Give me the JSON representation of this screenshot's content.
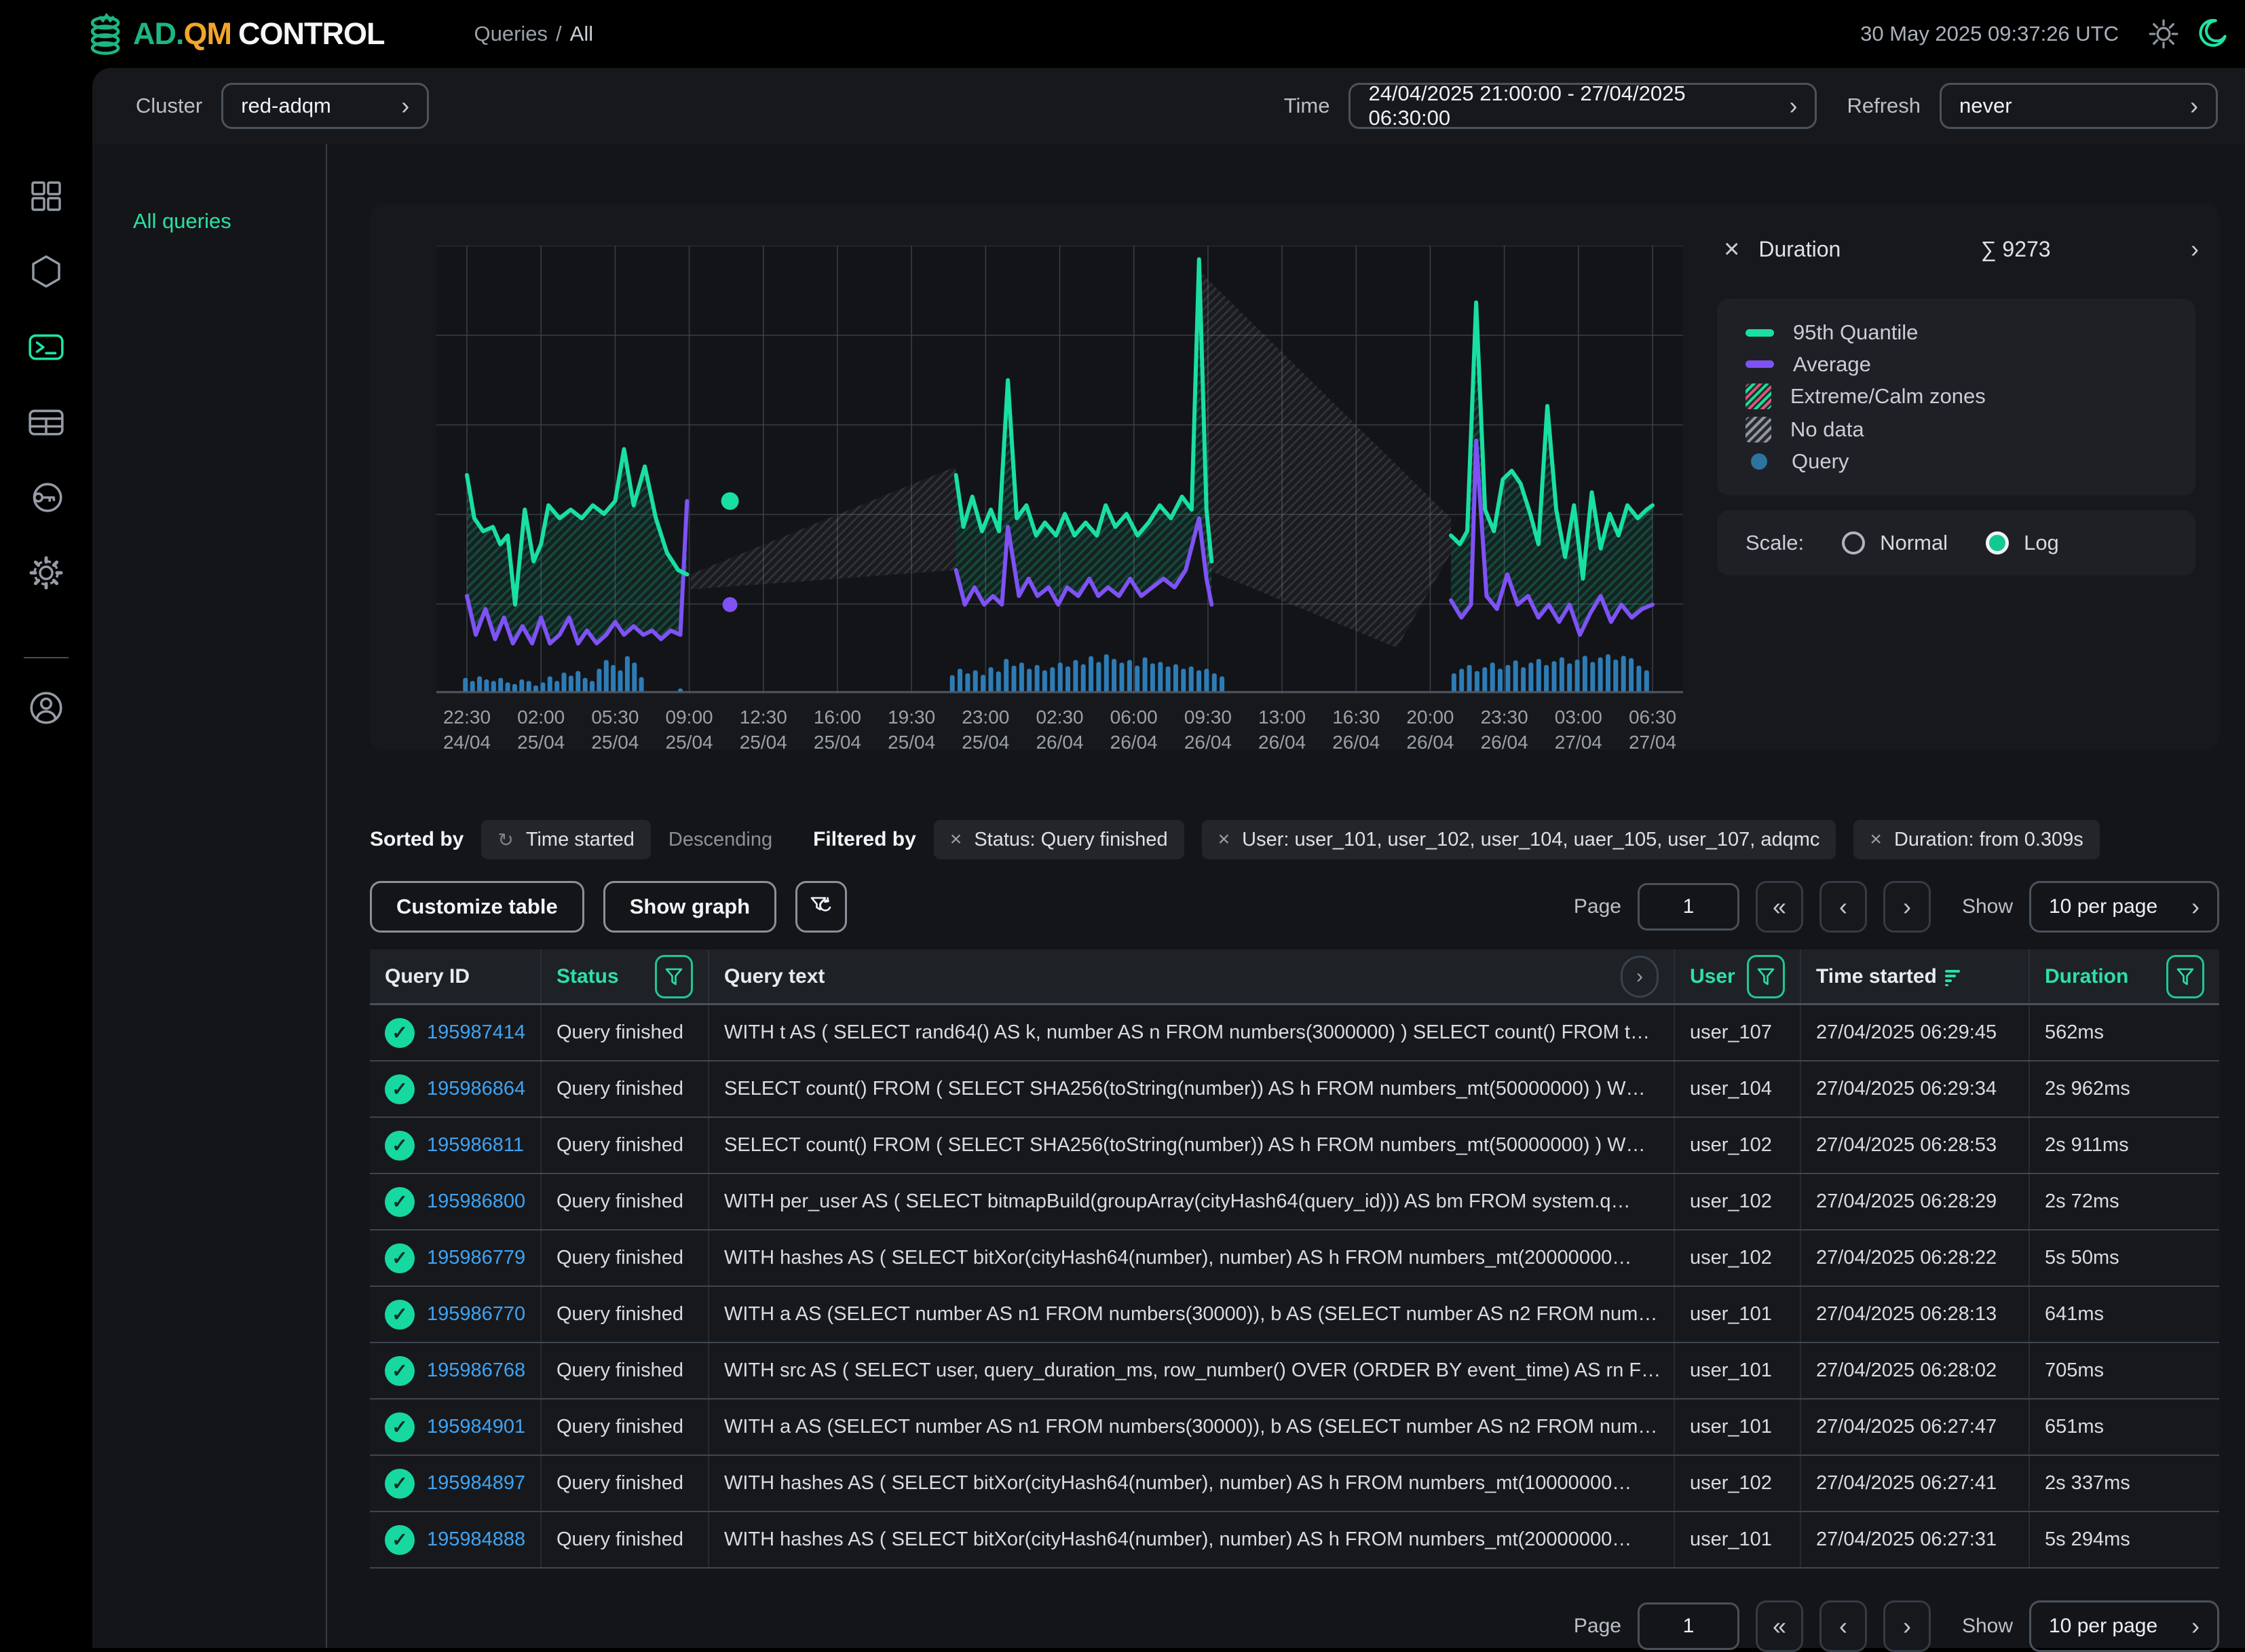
{
  "header": {
    "brand": {
      "ad": "AD.",
      "qm": "QM",
      "control": "CONTROL"
    },
    "breadcrumb": {
      "section": "Queries",
      "separator": "/",
      "page": "All"
    },
    "datetime": "30 May 2025 09:37:26 UTC"
  },
  "sidebar": {
    "items": [
      {
        "name": "dashboard",
        "icon": "grid-icon",
        "active": false
      },
      {
        "name": "nodes",
        "icon": "hexagon-icon",
        "active": false
      },
      {
        "name": "queries",
        "icon": "terminal-icon",
        "active": true
      },
      {
        "name": "tables",
        "icon": "table-icon",
        "active": false
      },
      {
        "name": "access",
        "icon": "key-icon",
        "active": false
      },
      {
        "name": "settings",
        "icon": "gear-icon",
        "active": false
      },
      {
        "name": "profile",
        "icon": "user-icon",
        "active": false
      }
    ]
  },
  "toolbar": {
    "cluster": {
      "label": "Cluster",
      "value": "red-adqm"
    },
    "time": {
      "label": "Time",
      "value": "24/04/2025 21:00:00 - 27/04/2025 06:30:00"
    },
    "refresh": {
      "label": "Refresh",
      "value": "never"
    }
  },
  "nav_panel": {
    "all_queries": "All queries"
  },
  "chart_data": {
    "type": "line",
    "title": "Duration",
    "sum_sigma": "∑",
    "sum_value": "9273",
    "expand_chevron": "›",
    "scale": {
      "label": "Scale:",
      "options": [
        "Normal",
        "Log"
      ],
      "selected": "Log"
    },
    "legend": [
      {
        "label": "95th Quantile",
        "swatch": "line-green"
      },
      {
        "label": "Average",
        "swatch": "line-purple"
      },
      {
        "label": "Extreme/Calm zones",
        "swatch": "hatch-zones"
      },
      {
        "label": "No data",
        "swatch": "hatch-nodata"
      },
      {
        "label": "Query",
        "swatch": "dot-blue"
      }
    ],
    "colors": {
      "q95": "#19dfa2",
      "avg": "#7e52f5",
      "histogram": "#2e7cb5",
      "query_dot": "#2d739f",
      "grid": "#3d444d"
    },
    "x_ticks": [
      {
        "time": "22:30",
        "date": "24/04"
      },
      {
        "time": "02:00",
        "date": "25/04"
      },
      {
        "time": "05:30",
        "date": "25/04"
      },
      {
        "time": "09:00",
        "date": "25/04"
      },
      {
        "time": "12:30",
        "date": "25/04"
      },
      {
        "time": "16:00",
        "date": "25/04"
      },
      {
        "time": "19:30",
        "date": "25/04"
      },
      {
        "time": "23:00",
        "date": "25/04"
      },
      {
        "time": "02:30",
        "date": "26/04"
      },
      {
        "time": "06:00",
        "date": "26/04"
      },
      {
        "time": "09:30",
        "date": "26/04"
      },
      {
        "time": "13:00",
        "date": "26/04"
      },
      {
        "time": "16:30",
        "date": "26/04"
      },
      {
        "time": "20:00",
        "date": "26/04"
      },
      {
        "time": "23:30",
        "date": "26/04"
      },
      {
        "time": "03:00",
        "date": "27/04"
      },
      {
        "time": "06:30",
        "date": "27/04"
      }
    ],
    "series": {
      "q95_segments": [
        [
          [
            0,
            0.5
          ],
          [
            0.1,
            0.4
          ],
          [
            0.22,
            0.37
          ],
          [
            0.35,
            0.38
          ],
          [
            0.45,
            0.34
          ],
          [
            0.55,
            0.36
          ],
          [
            0.65,
            0.2
          ],
          [
            0.78,
            0.42
          ],
          [
            0.9,
            0.3
          ],
          [
            1.0,
            0.34
          ],
          [
            1.1,
            0.43
          ],
          [
            1.25,
            0.4
          ],
          [
            1.4,
            0.42
          ],
          [
            1.55,
            0.4
          ],
          [
            1.7,
            0.43
          ],
          [
            1.85,
            0.41
          ],
          [
            2.0,
            0.44
          ],
          [
            2.12,
            0.56
          ],
          [
            2.25,
            0.43
          ],
          [
            2.4,
            0.52
          ],
          [
            2.55,
            0.4
          ],
          [
            2.7,
            0.32
          ],
          [
            2.85,
            0.28
          ],
          [
            2.97,
            0.27
          ]
        ],
        [
          [
            6.6,
            0.5
          ],
          [
            6.7,
            0.38
          ],
          [
            6.82,
            0.45
          ],
          [
            6.95,
            0.37
          ],
          [
            7.07,
            0.42
          ],
          [
            7.18,
            0.37
          ],
          [
            7.3,
            0.72
          ],
          [
            7.42,
            0.4
          ],
          [
            7.55,
            0.43
          ],
          [
            7.68,
            0.36
          ],
          [
            7.8,
            0.39
          ],
          [
            7.95,
            0.36
          ],
          [
            8.07,
            0.41
          ],
          [
            8.2,
            0.36
          ],
          [
            8.35,
            0.39
          ],
          [
            8.5,
            0.36
          ],
          [
            8.62,
            0.43
          ],
          [
            8.75,
            0.38
          ],
          [
            8.9,
            0.41
          ],
          [
            9.05,
            0.36
          ],
          [
            9.2,
            0.39
          ],
          [
            9.35,
            0.43
          ],
          [
            9.5,
            0.4
          ],
          [
            9.65,
            0.45
          ],
          [
            9.78,
            0.42
          ],
          [
            9.88,
            1.0
          ],
          [
            9.98,
            0.42
          ],
          [
            10.05,
            0.3
          ]
        ],
        [
          [
            13.28,
            0.36
          ],
          [
            13.4,
            0.34
          ],
          [
            13.5,
            0.37
          ],
          [
            13.62,
            0.9
          ],
          [
            13.74,
            0.42
          ],
          [
            13.86,
            0.37
          ],
          [
            13.98,
            0.49
          ],
          [
            14.1,
            0.51
          ],
          [
            14.22,
            0.48
          ],
          [
            14.35,
            0.41
          ],
          [
            14.46,
            0.34
          ],
          [
            14.58,
            0.66
          ],
          [
            14.7,
            0.42
          ],
          [
            14.82,
            0.31
          ],
          [
            14.94,
            0.43
          ],
          [
            15.06,
            0.26
          ],
          [
            15.18,
            0.46
          ],
          [
            15.3,
            0.33
          ],
          [
            15.42,
            0.41
          ],
          [
            15.54,
            0.36
          ],
          [
            15.66,
            0.43
          ],
          [
            15.8,
            0.4
          ],
          [
            15.92,
            0.42
          ],
          [
            16.0,
            0.43
          ]
        ]
      ],
      "avg_segments": [
        [
          [
            0,
            0.22
          ],
          [
            0.12,
            0.13
          ],
          [
            0.25,
            0.19
          ],
          [
            0.38,
            0.12
          ],
          [
            0.5,
            0.17
          ],
          [
            0.62,
            0.11
          ],
          [
            0.75,
            0.15
          ],
          [
            0.88,
            0.11
          ],
          [
            1.0,
            0.17
          ],
          [
            1.12,
            0.11
          ],
          [
            1.25,
            0.13
          ],
          [
            1.38,
            0.17
          ],
          [
            1.5,
            0.11
          ],
          [
            1.62,
            0.14
          ],
          [
            1.75,
            0.11
          ],
          [
            1.88,
            0.13
          ],
          [
            2.0,
            0.16
          ],
          [
            2.12,
            0.13
          ],
          [
            2.25,
            0.15
          ],
          [
            2.38,
            0.13
          ],
          [
            2.5,
            0.14
          ],
          [
            2.62,
            0.12
          ],
          [
            2.75,
            0.14
          ],
          [
            2.88,
            0.13
          ],
          [
            2.97,
            0.44
          ]
        ],
        [
          [
            6.6,
            0.28
          ],
          [
            6.72,
            0.2
          ],
          [
            6.85,
            0.24
          ],
          [
            6.98,
            0.2
          ],
          [
            7.1,
            0.22
          ],
          [
            7.22,
            0.2
          ],
          [
            7.3,
            0.38
          ],
          [
            7.45,
            0.22
          ],
          [
            7.58,
            0.26
          ],
          [
            7.7,
            0.22
          ],
          [
            7.85,
            0.24
          ],
          [
            7.98,
            0.2
          ],
          [
            8.1,
            0.24
          ],
          [
            8.25,
            0.22
          ],
          [
            8.4,
            0.26
          ],
          [
            8.52,
            0.22
          ],
          [
            8.65,
            0.24
          ],
          [
            8.8,
            0.22
          ],
          [
            8.95,
            0.26
          ],
          [
            9.1,
            0.22
          ],
          [
            9.25,
            0.24
          ],
          [
            9.4,
            0.26
          ],
          [
            9.55,
            0.24
          ],
          [
            9.7,
            0.28
          ],
          [
            9.88,
            0.4
          ],
          [
            9.98,
            0.26
          ],
          [
            10.05,
            0.2
          ]
        ],
        [
          [
            13.28,
            0.21
          ],
          [
            13.42,
            0.17
          ],
          [
            13.55,
            0.2
          ],
          [
            13.62,
            0.58
          ],
          [
            13.76,
            0.22
          ],
          [
            13.9,
            0.19
          ],
          [
            14.04,
            0.27
          ],
          [
            14.18,
            0.2
          ],
          [
            14.32,
            0.22
          ],
          [
            14.46,
            0.17
          ],
          [
            14.6,
            0.2
          ],
          [
            14.74,
            0.16
          ],
          [
            14.88,
            0.2
          ],
          [
            15.02,
            0.13
          ],
          [
            15.16,
            0.18
          ],
          [
            15.3,
            0.22
          ],
          [
            15.44,
            0.16
          ],
          [
            15.58,
            0.2
          ],
          [
            15.72,
            0.17
          ],
          [
            15.86,
            0.19
          ],
          [
            16.0,
            0.2
          ]
        ]
      ],
      "markers": [
        {
          "series": "q95",
          "x": 3.55,
          "y": 0.44
        },
        {
          "series": "avg",
          "x": 3.55,
          "y": 0.2
        }
      ],
      "no_data_zones": [
        [
          [
            3.02,
            0.27
          ],
          [
            6.6,
            0.52
          ],
          [
            6.6,
            0.28
          ],
          [
            3.02,
            0.235
          ]
        ],
        [
          [
            9.9,
            0.97
          ],
          [
            13.28,
            0.4
          ],
          [
            13.28,
            0.32
          ],
          [
            12.55,
            0.1
          ],
          [
            10.0,
            0.28
          ]
        ]
      ],
      "histogram": {
        "clusters": [
          {
            "start": -0.02,
            "step": 0.095,
            "heights": [
              0.38,
              0.3,
              0.42,
              0.34,
              0.3,
              0.38,
              0.26,
              0.22,
              0.34,
              0.3,
              0.18,
              0.26,
              0.42,
              0.3,
              0.52,
              0.44,
              0.56,
              0.38,
              0.3,
              0.62,
              0.85,
              0.72,
              0.58,
              0.95,
              0.78,
              0.4
            ]
          },
          {
            "start": 2.88,
            "step": 0.1,
            "heights": [
              0.1
            ]
          },
          {
            "start": 6.55,
            "step": 0.104,
            "heights": [
              0.45,
              0.62,
              0.5,
              0.58,
              0.46,
              0.66,
              0.55,
              0.88,
              0.7,
              0.78,
              0.62,
              0.72,
              0.58,
              0.66,
              0.78,
              0.68,
              0.85,
              0.74,
              0.95,
              0.8,
              1.0,
              0.88,
              0.78,
              0.85,
              0.7,
              0.92,
              0.76,
              0.8,
              0.68,
              0.74,
              0.62,
              0.68,
              0.58,
              0.62,
              0.5,
              0.42
            ]
          },
          {
            "start": 13.32,
            "step": 0.104,
            "heights": [
              0.5,
              0.62,
              0.72,
              0.56,
              0.66,
              0.78,
              0.62,
              0.72,
              0.84,
              0.66,
              0.78,
              0.88,
              0.72,
              0.82,
              0.92,
              0.76,
              0.86,
              0.96,
              0.8,
              0.92,
              1.0,
              0.86,
              0.96,
              0.9,
              0.7,
              0.58
            ]
          }
        ]
      }
    }
  },
  "filters": {
    "sorted_by_label": "Sorted by",
    "sort_field": "Time started",
    "sort_direction": "Descending",
    "filtered_by_label": "Filtered by",
    "chips": [
      {
        "label": "Status: Query finished"
      },
      {
        "label": "User: user_101, user_102, user_104, uaer_105, user_107, adqmc"
      },
      {
        "label": "Duration: from 0.309s"
      }
    ]
  },
  "table_controls": {
    "customize_label": "Customize table",
    "show_graph_label": "Show graph",
    "page_label": "Page",
    "page_value": "1",
    "show_label": "Show",
    "per_page_value": "10 per page",
    "pagination": {
      "first": "«",
      "prev": "‹",
      "next": "›"
    }
  },
  "table": {
    "columns": {
      "query_id": "Query ID",
      "status": "Status",
      "query_text": "Query text",
      "user": "User",
      "time_started": "Time started",
      "duration": "Duration"
    },
    "rows": [
      {
        "id": "195987414",
        "status": "Query finished",
        "query": "WITH t AS ( SELECT rand64() AS k, number AS n FROM numbers(3000000) ) SELECT count() FROM t…",
        "user": "user_107",
        "time_started": "27/04/2025 06:29:45",
        "duration": "562ms"
      },
      {
        "id": "195986864",
        "status": "Query finished",
        "query": "SELECT count() FROM ( SELECT SHA256(toString(number)) AS h FROM numbers_mt(50000000) ) W…",
        "user": "user_104",
        "time_started": "27/04/2025 06:29:34",
        "duration": "2s 962ms"
      },
      {
        "id": "195986811",
        "status": "Query finished",
        "query": "SELECT count() FROM ( SELECT SHA256(toString(number)) AS h FROM numbers_mt(50000000) ) W…",
        "user": "user_102",
        "time_started": "27/04/2025 06:28:53",
        "duration": "2s 911ms"
      },
      {
        "id": "195986800",
        "status": "Query finished",
        "query": "WITH per_user AS ( SELECT bitmapBuild(groupArray(cityHash64(query_id))) AS bm FROM system.q…",
        "user": "user_102",
        "time_started": "27/04/2025 06:28:29",
        "duration": "2s 72ms"
      },
      {
        "id": "195986779",
        "status": "Query finished",
        "query": "WITH hashes AS ( SELECT bitXor(cityHash64(number), number) AS h FROM numbers_mt(20000000…",
        "user": "user_102",
        "time_started": "27/04/2025 06:28:22",
        "duration": "5s 50ms"
      },
      {
        "id": "195986770",
        "status": "Query finished",
        "query": "WITH a AS (SELECT number AS n1 FROM numbers(30000)), b AS (SELECT number AS n2 FROM num…",
        "user": "user_101",
        "time_started": "27/04/2025 06:28:13",
        "duration": "641ms"
      },
      {
        "id": "195986768",
        "status": "Query finished",
        "query": "WITH src AS ( SELECT user, query_duration_ms, row_number() OVER (ORDER BY event_time) AS rn F…",
        "user": "user_101",
        "time_started": "27/04/2025 06:28:02",
        "duration": "705ms"
      },
      {
        "id": "195984901",
        "status": "Query finished",
        "query": "WITH a AS (SELECT number AS n1 FROM numbers(30000)), b AS (SELECT number AS n2 FROM num…",
        "user": "user_101",
        "time_started": "27/04/2025 06:27:47",
        "duration": "651ms"
      },
      {
        "id": "195984897",
        "status": "Query finished",
        "query": "WITH hashes AS ( SELECT bitXor(cityHash64(number), number) AS h FROM numbers_mt(10000000…",
        "user": "user_102",
        "time_started": "27/04/2025 06:27:41",
        "duration": "2s 337ms"
      },
      {
        "id": "195984888",
        "status": "Query finished",
        "query": "WITH hashes AS ( SELECT bitXor(cityHash64(number), number) AS h FROM numbers_mt(20000000…",
        "user": "user_101",
        "time_started": "27/04/2025 06:27:31",
        "duration": "5s 294ms"
      }
    ]
  },
  "glyphs": {
    "close": "×",
    "check": "✓",
    "chevron_right": "›",
    "reset": "↺",
    "refresh": "↻"
  }
}
